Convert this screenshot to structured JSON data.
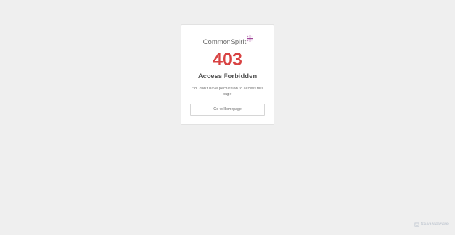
{
  "brand": {
    "name": "CommonSpirit",
    "mark_icon": "plus-cross-logo-icon",
    "mark_color": "#a0479a"
  },
  "error": {
    "code": "403",
    "title": "Access Forbidden",
    "message": "You don't have permission to access this page.",
    "code_color": "#d84242"
  },
  "actions": {
    "home_label": "Go to Homepage"
  },
  "watermark": {
    "text": "ScanMalware",
    "icon": "scanmalware-logo-icon"
  }
}
